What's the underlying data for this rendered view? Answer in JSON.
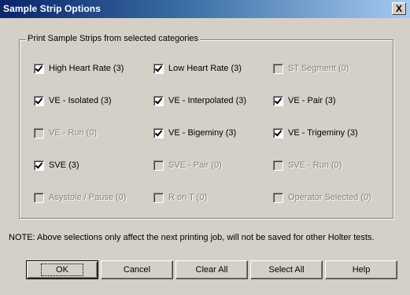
{
  "window": {
    "title": "Sample Strip Options",
    "close_glyph": "X"
  },
  "group": {
    "legend": "Print Sample Strips from selected categories",
    "checkboxes": [
      {
        "label": "High Heart Rate (3)",
        "checked": true,
        "enabled": true
      },
      {
        "label": "Low Heart Rate (3)",
        "checked": true,
        "enabled": true
      },
      {
        "label": "ST Segment (0)",
        "checked": false,
        "enabled": false
      },
      {
        "label": "VE - Isolated (3)",
        "checked": true,
        "enabled": true
      },
      {
        "label": "VE - Interpolated (3)",
        "checked": true,
        "enabled": true
      },
      {
        "label": "VE - Pair (3)",
        "checked": true,
        "enabled": true
      },
      {
        "label": "VE - Run (0)",
        "checked": false,
        "enabled": false
      },
      {
        "label": "VE  - Bigeminy (3)",
        "checked": true,
        "enabled": true
      },
      {
        "label": "VE - Trigeminy (3)",
        "checked": true,
        "enabled": true
      },
      {
        "label": "SVE (3)",
        "checked": true,
        "enabled": true
      },
      {
        "label": "SVE - Pair (0)",
        "checked": false,
        "enabled": false
      },
      {
        "label": "SVE  - Run (0)",
        "checked": false,
        "enabled": false
      },
      {
        "label": "Asystole / Pause (0)",
        "checked": false,
        "enabled": false
      },
      {
        "label": "R on T (0)",
        "checked": false,
        "enabled": false
      },
      {
        "label": "Operator Selected (0)",
        "checked": false,
        "enabled": false
      }
    ]
  },
  "note": "NOTE: Above selections only affect the next printing job, will not be saved for other Holter tests.",
  "buttons": {
    "ok": "OK",
    "cancel": "Cancel",
    "clear_all": "Clear All",
    "select_all": "Select All",
    "help": "Help"
  },
  "colors": {
    "dialog_bg": "#d4d0c8",
    "titlebar_start": "#0a246a",
    "titlebar_end": "#a6caf0",
    "disabled_text": "#808080"
  }
}
